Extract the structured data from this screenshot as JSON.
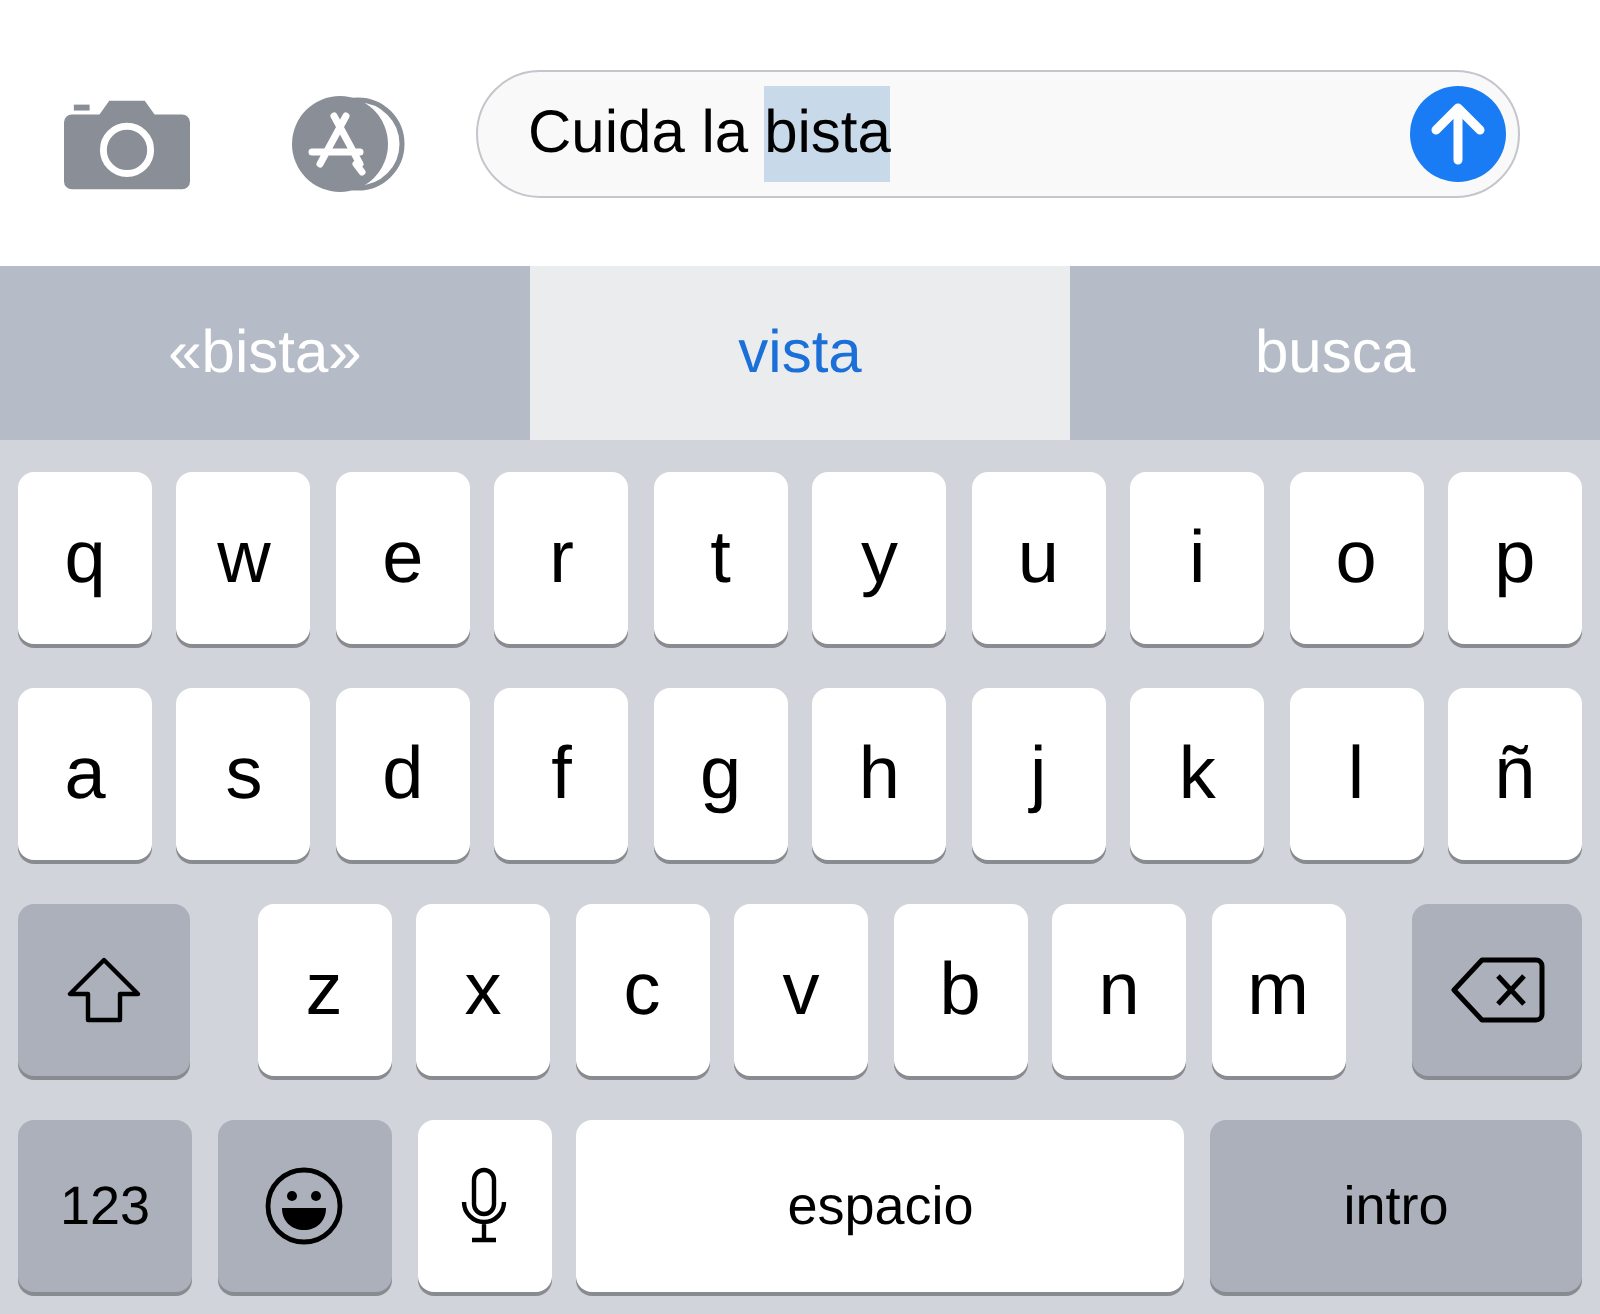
{
  "message_field": {
    "parts": [
      {
        "text": "Cuida la",
        "selected": false
      },
      {
        "text": "bista",
        "selected": true
      }
    ]
  },
  "suggestions": [
    {
      "label": "«bista»",
      "selected": false
    },
    {
      "label": "vista",
      "selected": true
    },
    {
      "label": "busca",
      "selected": false
    }
  ],
  "keyboard_rows": [
    {
      "keys": [
        {
          "kind": "letter",
          "label": "q"
        },
        {
          "kind": "letter",
          "label": "w"
        },
        {
          "kind": "letter",
          "label": "e"
        },
        {
          "kind": "letter",
          "label": "r"
        },
        {
          "kind": "letter",
          "label": "t"
        },
        {
          "kind": "letter",
          "label": "y"
        },
        {
          "kind": "letter",
          "label": "u"
        },
        {
          "kind": "letter",
          "label": "i"
        },
        {
          "kind": "letter",
          "label": "o"
        },
        {
          "kind": "letter",
          "label": "p"
        }
      ]
    },
    {
      "keys": [
        {
          "kind": "letter",
          "label": "a"
        },
        {
          "kind": "letter",
          "label": "s"
        },
        {
          "kind": "letter",
          "label": "d"
        },
        {
          "kind": "letter",
          "label": "f"
        },
        {
          "kind": "letter",
          "label": "g"
        },
        {
          "kind": "letter",
          "label": "h"
        },
        {
          "kind": "letter",
          "label": "j"
        },
        {
          "kind": "letter",
          "label": "k"
        },
        {
          "kind": "letter",
          "label": "l"
        },
        {
          "kind": "letter",
          "label": "ñ"
        }
      ]
    },
    {
      "keys": [
        {
          "kind": "shift"
        },
        {
          "kind": "letter",
          "label": "z"
        },
        {
          "kind": "letter",
          "label": "x"
        },
        {
          "kind": "letter",
          "label": "c"
        },
        {
          "kind": "letter",
          "label": "v"
        },
        {
          "kind": "letter",
          "label": "b"
        },
        {
          "kind": "letter",
          "label": "n"
        },
        {
          "kind": "letter",
          "label": "m"
        },
        {
          "kind": "delete"
        }
      ]
    },
    {
      "keys": [
        {
          "kind": "numbers",
          "label": "123"
        },
        {
          "kind": "emoji"
        },
        {
          "kind": "dictation"
        },
        {
          "kind": "space",
          "label": "espacio"
        },
        {
          "kind": "return",
          "label": "intro"
        }
      ]
    }
  ]
}
